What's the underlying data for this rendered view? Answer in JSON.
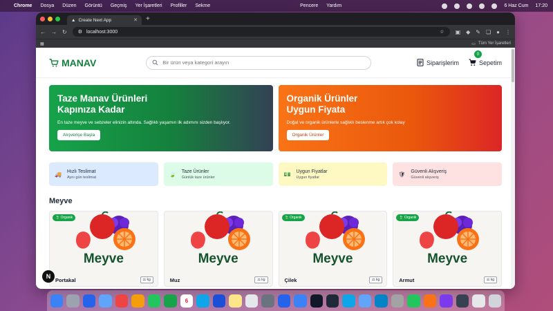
{
  "menubar": {
    "apple_icon": "",
    "app": "Chrome",
    "items": [
      "Dosya",
      "Düzen",
      "Görüntü",
      "Geçmiş",
      "Yer İşaretleri",
      "Profiller",
      "Sekme"
    ],
    "right_items": [
      "Pencere",
      "Yardım"
    ],
    "date": "6 Haz Cum",
    "time": "17:20"
  },
  "browser": {
    "tab_title": "Create Next App",
    "url": "localhost:3000",
    "bookmarks_label": "Tüm Yer İşaretleri"
  },
  "header": {
    "logo": "MANAV",
    "search_placeholder": "Bir ürün veya kategori arayın",
    "orders_label": "Siparişlerim",
    "cart_label": "Sepetim",
    "cart_count": "0"
  },
  "banners": [
    {
      "title_line1": "Taze Manav Ürünleri",
      "title_line2": "Kapınıza Kadar",
      "text": "En taze meyve ve sebzeler elinizin altında. Sağlıklı yaşamın ilk adımını sizden başlıyor.",
      "button": "Alışverişe Başla"
    },
    {
      "title_line1": "Organik Ürünler",
      "title_line2": "Uygun Fiyata",
      "text": "Doğal ve organik ürünlerle sağlıklı beslenme artık çok kolay",
      "button": "Organik Ürünler"
    }
  ],
  "features": [
    {
      "title": "Hızlı Teslimat",
      "subtitle": "Aynı gün teslimat",
      "icon": "truck-icon",
      "bg": "#dbeafe"
    },
    {
      "title": "Taze Ürünler",
      "subtitle": "Günlük taze ürünler",
      "icon": "leaf-icon",
      "bg": "#dcfce7"
    },
    {
      "title": "Uygun Fiyatlar",
      "subtitle": "Uygun fiyatlar",
      "icon": "money-icon",
      "bg": "#fef9c3"
    },
    {
      "title": "Güvenli Alışveriş",
      "subtitle": "Güvenli alışveriş",
      "icon": "shield-icon",
      "bg": "#fee2e2"
    }
  ],
  "section_title": "Meyve",
  "products": [
    {
      "name": "Portakal",
      "category": "Meyve",
      "badge": "Organik",
      "unit": "kg"
    },
    {
      "name": "Muz",
      "category": "Meyve",
      "badge": "",
      "unit": "kg"
    },
    {
      "name": "Çilek",
      "category": "Meyve",
      "badge": "Organik",
      "unit": "kg"
    },
    {
      "name": "Armut",
      "category": "Meyve",
      "badge": "Organik",
      "unit": "kg"
    }
  ],
  "next_badge": "N",
  "dock": {
    "calendar_day": "6"
  },
  "colors": {
    "brand_green": "#15803d",
    "accent_orange": "#ea580c"
  }
}
